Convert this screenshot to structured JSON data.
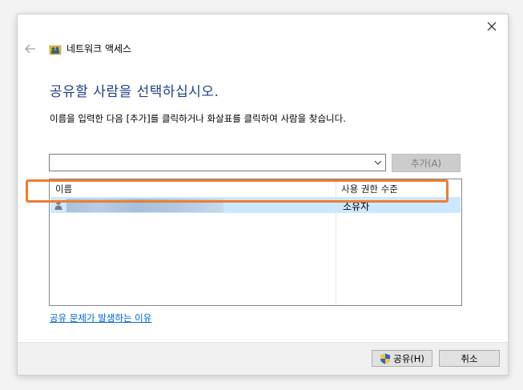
{
  "window": {
    "title": "네트워크 액세스",
    "close_icon": "close-icon",
    "back_icon": "back-arrow-icon",
    "title_icon": "network-users-icon"
  },
  "main": {
    "heading": "공유할 사람을 선택하십시오.",
    "instruction": "이름을 입력한 다음 [추가]를 클릭하거나 화살표를 클릭하여 사람을 찾습니다.",
    "combo_value": "",
    "add_button_label": "추가(A)",
    "list": {
      "columns": [
        "이름",
        "사용 권한 수준"
      ],
      "rows": [
        {
          "name": "",
          "permission": "소유자",
          "icon": "user-icon",
          "selected": true
        }
      ]
    },
    "help_link": "공유 문제가 발생하는 이유"
  },
  "footer": {
    "share_label": "공유(H)",
    "share_icon": "uac-shield-icon",
    "cancel_label": "취소"
  },
  "colors": {
    "heading": "#1e3f8a",
    "selection": "#cce8ff",
    "highlight_box": "#ed7d31",
    "link": "#0066cc"
  }
}
